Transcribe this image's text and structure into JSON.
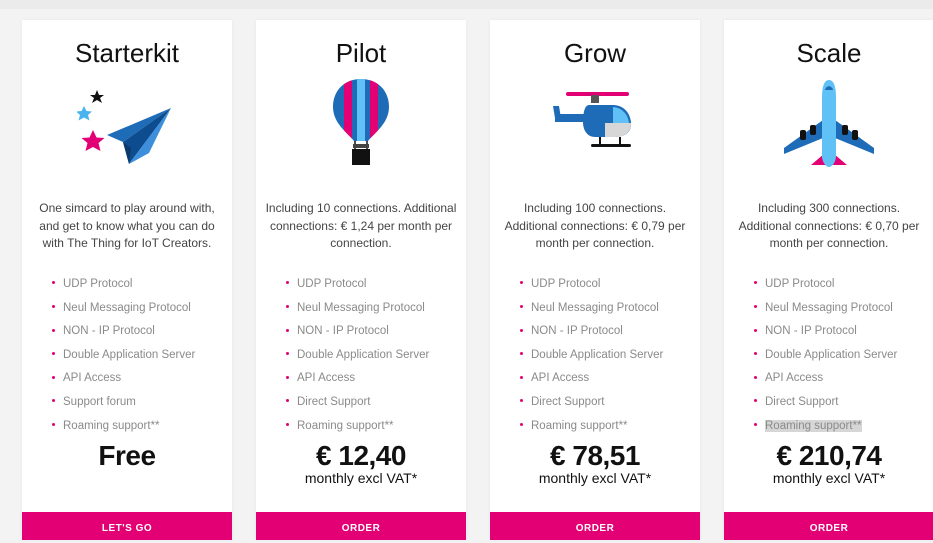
{
  "colors": {
    "accent": "#e20074",
    "page_bg": "#f3f3f3",
    "card_bg": "#ffffff"
  },
  "plans": [
    {
      "title": "Starterkit",
      "icon": "paper-plane-icon",
      "description": "One simcard to play around with, and get to know what you can do with The Thing for IoT Creators.",
      "features": [
        "UDP Protocol",
        "Neul Messaging Protocol",
        "NON - IP Protocol",
        "Double Application Server",
        "API Access",
        "Support forum",
        "Roaming support**"
      ],
      "price": "Free",
      "price_sub": "",
      "cta": "LET'S GO"
    },
    {
      "title": "Pilot",
      "icon": "hot-air-balloon-icon",
      "description": "Including 10 connections. Additional connections: € 1,24 per month per connection.",
      "features": [
        "UDP Protocol",
        "Neul Messaging Protocol",
        "NON - IP Protocol",
        "Double Application Server",
        "API Access",
        "Direct Support",
        "Roaming support**"
      ],
      "price": "€ 12,40",
      "price_sub": "monthly excl VAT*",
      "cta": "ORDER"
    },
    {
      "title": "Grow",
      "icon": "helicopter-icon",
      "description": "Including 100 connections. Additional connections: € 0,79 per month per connection.",
      "features": [
        "UDP Protocol",
        "Neul Messaging Protocol",
        "NON - IP Protocol",
        "Double Application Server",
        "API Access",
        "Direct Support",
        "Roaming support**"
      ],
      "price": "€ 78,51",
      "price_sub": "monthly excl VAT*",
      "cta": "ORDER"
    },
    {
      "title": "Scale",
      "icon": "airplane-icon",
      "description": "Including 300 connections. Additional connections: € 0,70 per month per connection.",
      "features": [
        "UDP Protocol",
        "Neul Messaging Protocol",
        "NON - IP Protocol",
        "Double Application Server",
        "API Access",
        "Direct Support",
        "Roaming support**"
      ],
      "price": "€ 210,74",
      "price_sub": "monthly excl VAT*",
      "cta": "ORDER"
    }
  ]
}
